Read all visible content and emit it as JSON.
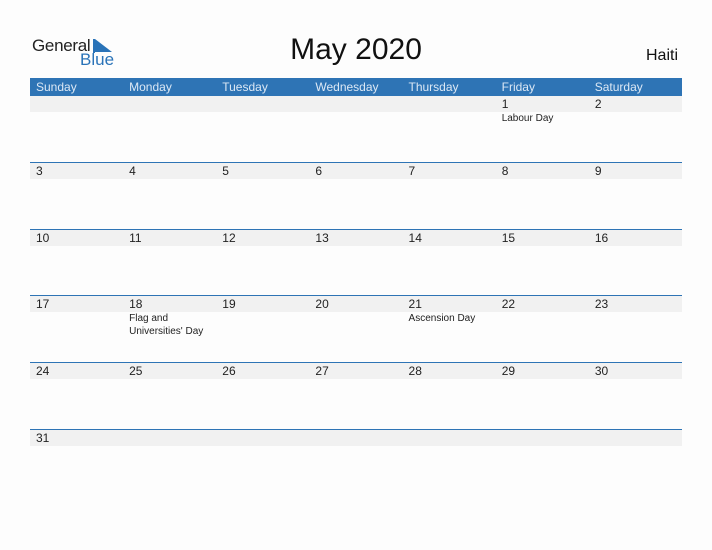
{
  "brand": {
    "word1": "General",
    "word2": "Blue",
    "accent_color": "#2e74b5"
  },
  "title": "May 2020",
  "country": "Haiti",
  "weekdays": [
    "Sunday",
    "Monday",
    "Tuesday",
    "Wednesday",
    "Thursday",
    "Friday",
    "Saturday"
  ],
  "weeks": [
    [
      {
        "day": ""
      },
      {
        "day": ""
      },
      {
        "day": ""
      },
      {
        "day": ""
      },
      {
        "day": ""
      },
      {
        "day": "1",
        "holiday": "Labour Day"
      },
      {
        "day": "2"
      }
    ],
    [
      {
        "day": "3"
      },
      {
        "day": "4"
      },
      {
        "day": "5"
      },
      {
        "day": "6"
      },
      {
        "day": "7"
      },
      {
        "day": "8"
      },
      {
        "day": "9"
      }
    ],
    [
      {
        "day": "10"
      },
      {
        "day": "11"
      },
      {
        "day": "12"
      },
      {
        "day": "13"
      },
      {
        "day": "14"
      },
      {
        "day": "15"
      },
      {
        "day": "16"
      }
    ],
    [
      {
        "day": "17"
      },
      {
        "day": "18",
        "holiday": "Flag and Universities' Day"
      },
      {
        "day": "19"
      },
      {
        "day": "20"
      },
      {
        "day": "21",
        "holiday": "Ascension Day"
      },
      {
        "day": "22"
      },
      {
        "day": "23"
      }
    ],
    [
      {
        "day": "24"
      },
      {
        "day": "25"
      },
      {
        "day": "26"
      },
      {
        "day": "27"
      },
      {
        "day": "28"
      },
      {
        "day": "29"
      },
      {
        "day": "30"
      }
    ],
    [
      {
        "day": "31"
      },
      {
        "day": ""
      },
      {
        "day": ""
      },
      {
        "day": ""
      },
      {
        "day": ""
      },
      {
        "day": ""
      },
      {
        "day": ""
      }
    ]
  ]
}
